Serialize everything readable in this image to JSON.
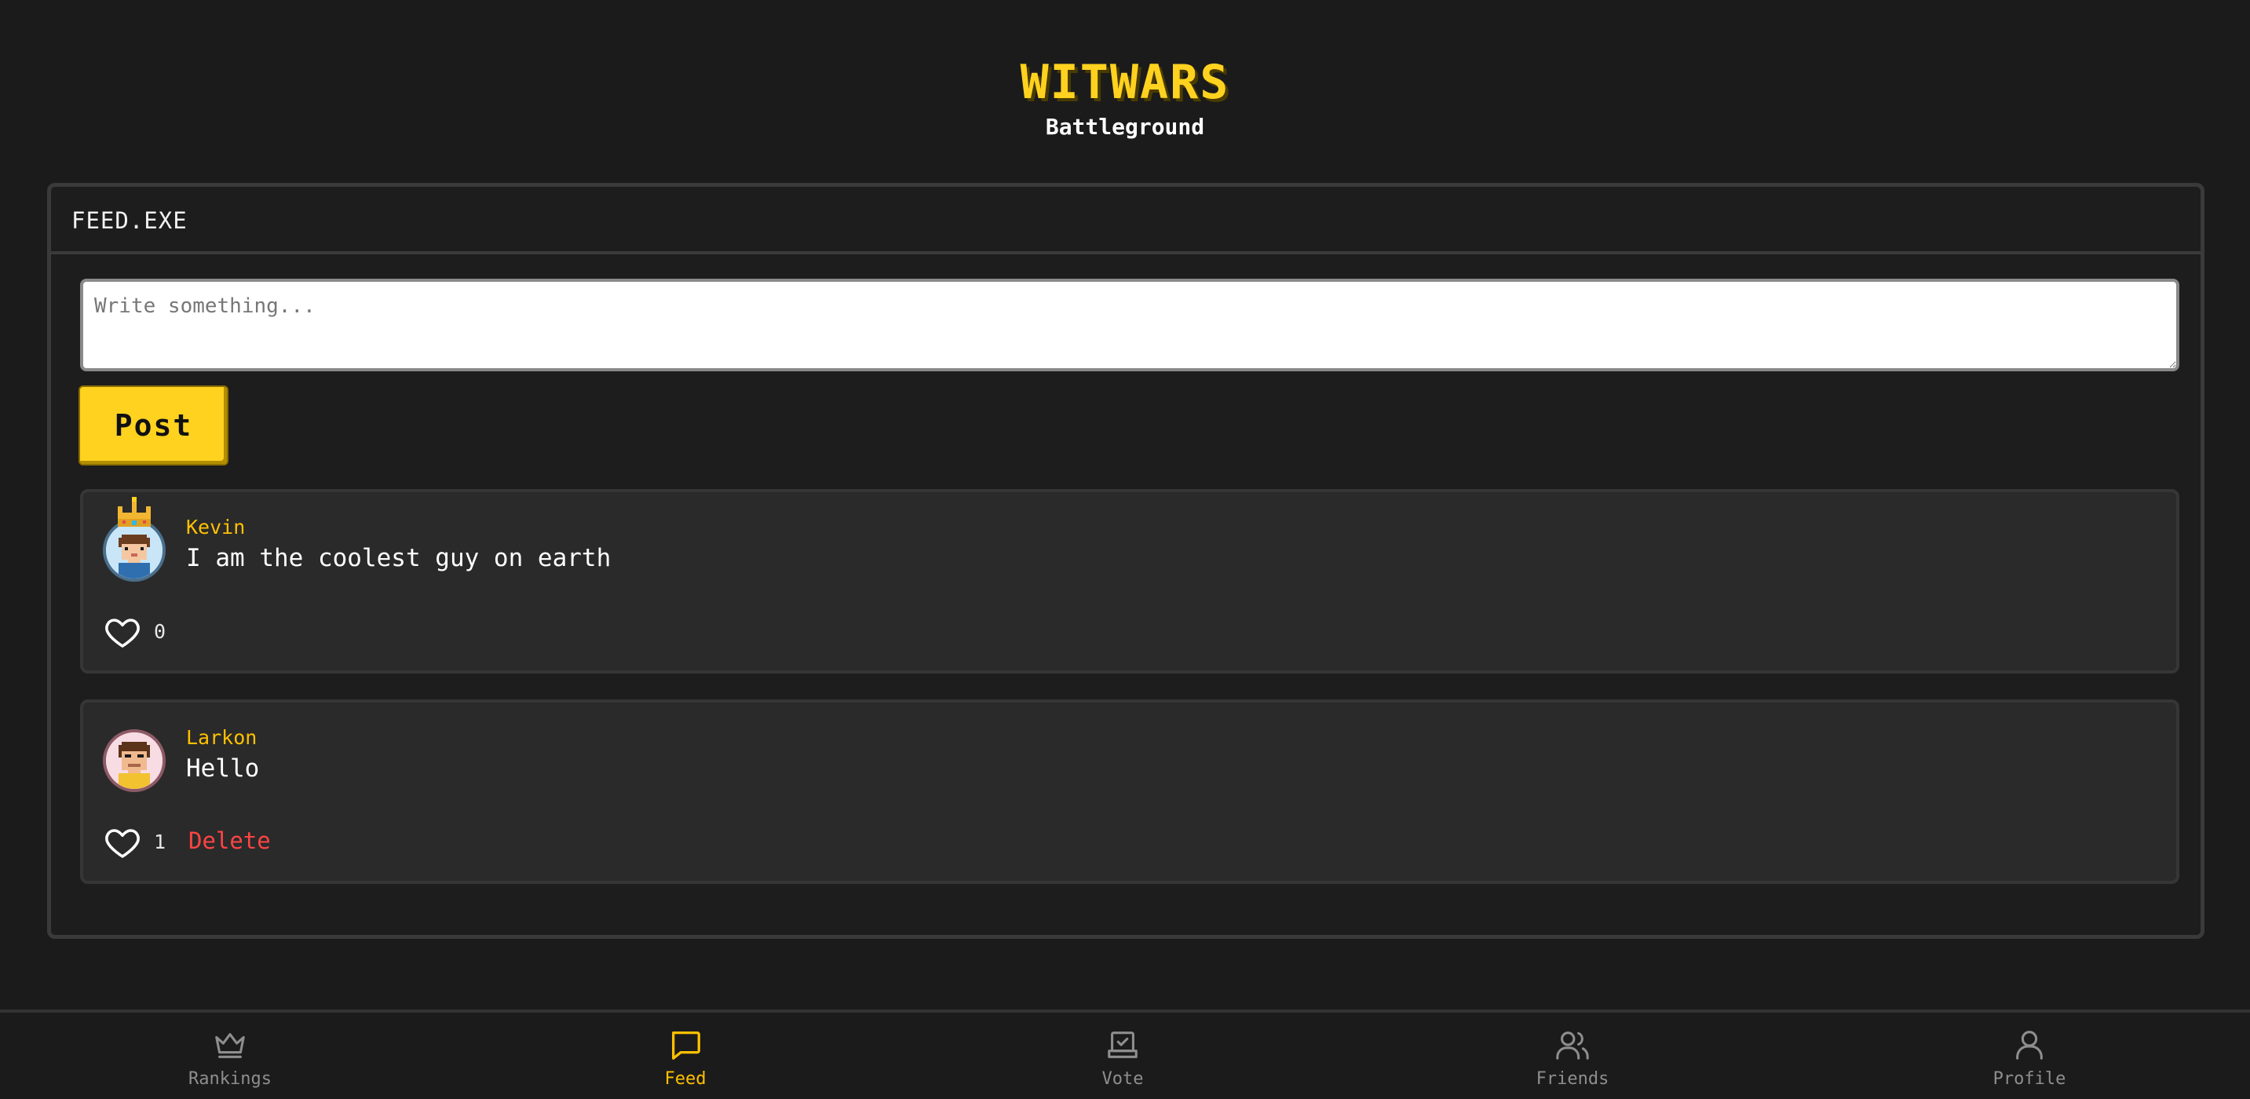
{
  "header": {
    "title": "WITWARS",
    "subtitle": "Battleground"
  },
  "window": {
    "title": "FEED.EXE"
  },
  "composer": {
    "placeholder": "Write something...",
    "value": "",
    "post_label": "Post"
  },
  "posts": [
    {
      "author": "Kevin",
      "text": "I am the coolest guy on earth",
      "likes": "0",
      "crowned": true,
      "avatar_icon": "pixel-avatar-blue-icon",
      "can_delete": false
    },
    {
      "author": "Larkon",
      "text": "Hello",
      "likes": "1",
      "crowned": false,
      "avatar_icon": "pixel-avatar-pink-icon",
      "can_delete": true,
      "delete_label": "Delete"
    }
  ],
  "nav": {
    "active": "Feed",
    "items": [
      {
        "label": "Rankings",
        "icon": "crown-icon"
      },
      {
        "label": "Feed",
        "icon": "chat-bubble-icon"
      },
      {
        "label": "Vote",
        "icon": "ballot-box-icon"
      },
      {
        "label": "Friends",
        "icon": "users-icon"
      },
      {
        "label": "Profile",
        "icon": "user-icon"
      }
    ]
  },
  "colors": {
    "background": "#1b1b1b",
    "accent": "#ffd21f",
    "author": "#ffc000",
    "delete": "#ff4444",
    "card": "#2a2a2a",
    "nav_inactive": "#8e8e8e"
  }
}
